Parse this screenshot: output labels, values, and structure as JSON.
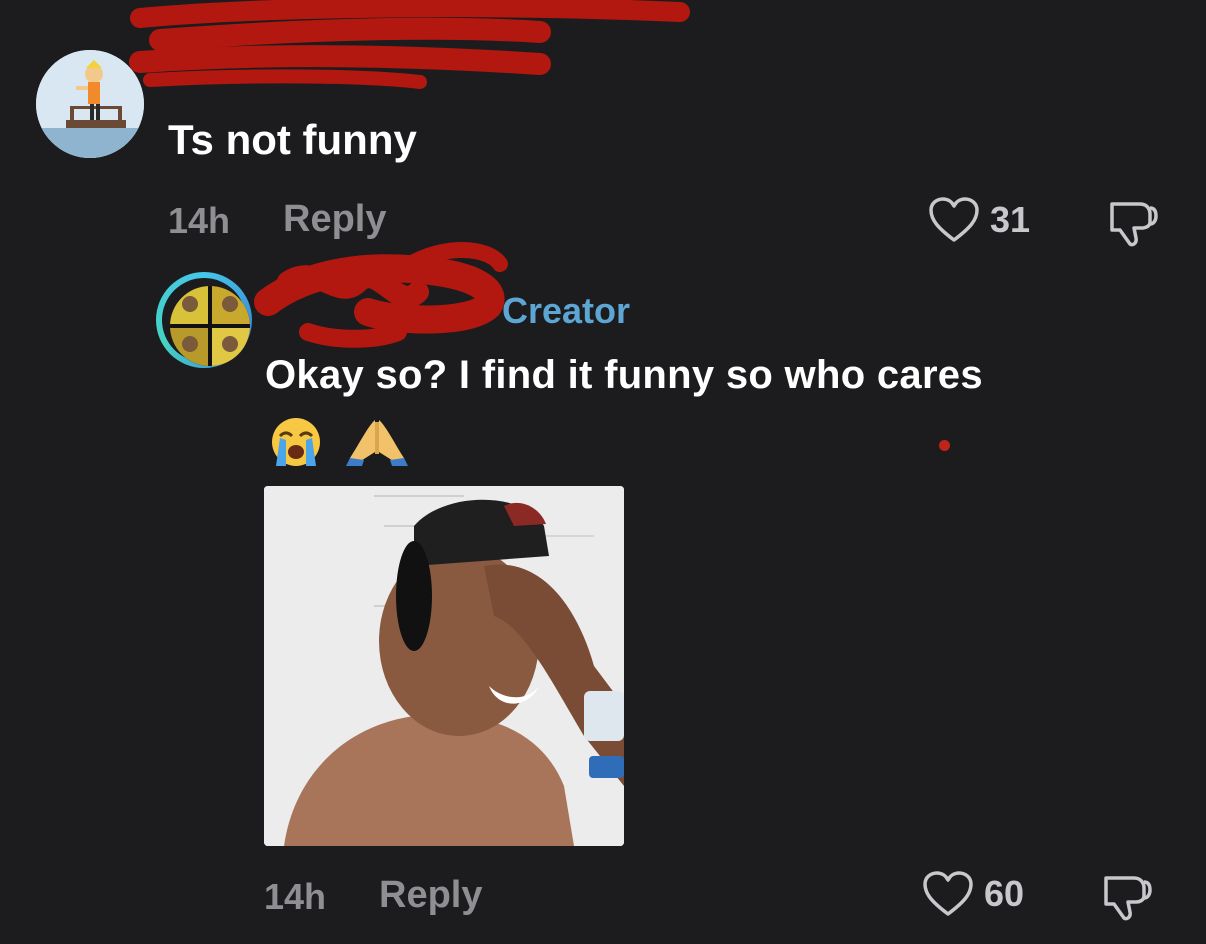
{
  "comment": {
    "text": "Ts not funny",
    "time": "14h",
    "reply_label": "Reply",
    "like_count": "31"
  },
  "reply": {
    "creator_tag": "Creator",
    "text": "Okay so? I find it funny so who cares",
    "emojis": [
      "😭",
      "🙏"
    ],
    "time": "14h",
    "reply_label": "Reply",
    "like_count": "60"
  },
  "colors": {
    "background": "#1c1c1e",
    "creator_tag": "#5da6d4",
    "redaction": "#b2180f",
    "muted_text": "#8e8e93"
  },
  "icons": {
    "like": "heart-outline-icon",
    "dislike": "thumbs-down-icon"
  }
}
